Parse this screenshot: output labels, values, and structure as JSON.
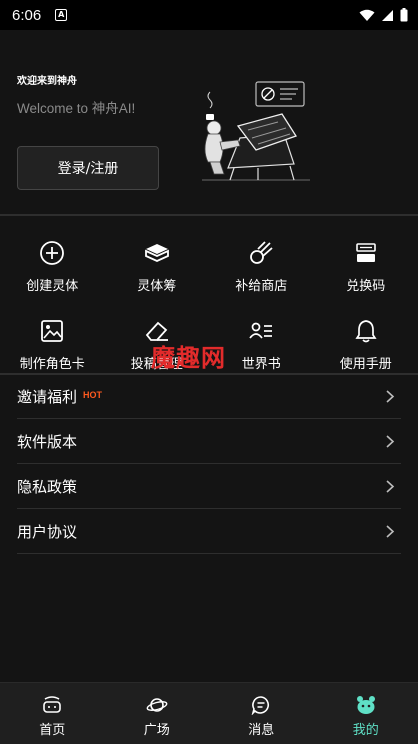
{
  "status_bar": {
    "time": "6:06",
    "notification_letter": "A"
  },
  "header": {
    "welcome_title": "欢迎来到神舟",
    "welcome_subtitle": "Welcome to 神舟AI!",
    "login_label": "登录/注册"
  },
  "grid": {
    "items": [
      {
        "label": "创建灵体",
        "icon": "plus-circle-icon"
      },
      {
        "label": "灵体筹",
        "icon": "cube-icon"
      },
      {
        "label": "补给商店",
        "icon": "meteor-icon"
      },
      {
        "label": "兑换码",
        "icon": "redeem-code-icon"
      },
      {
        "label": "制作角色卡",
        "icon": "image-icon"
      },
      {
        "label": "投稿管理",
        "icon": "eraser-icon"
      },
      {
        "label": "世界书",
        "icon": "contact-list-icon"
      },
      {
        "label": "使用手册",
        "icon": "bell-icon"
      }
    ]
  },
  "watermark": "魔趣网",
  "list": {
    "items": [
      {
        "label": "邀请福利",
        "badge": "HOT"
      },
      {
        "label": "软件版本"
      },
      {
        "label": "隐私政策"
      },
      {
        "label": "用户协议"
      }
    ]
  },
  "nav": {
    "items": [
      {
        "label": "首页",
        "icon": "home-icon"
      },
      {
        "label": "广场",
        "icon": "planet-icon"
      },
      {
        "label": "消息",
        "icon": "message-icon"
      },
      {
        "label": "我的",
        "icon": "mascot-icon"
      }
    ],
    "active_index": 3
  },
  "colors": {
    "background": "#141414",
    "accent": "#5fe0c6",
    "hot": "#ff5a1f",
    "watermark": "#e32b2b"
  }
}
